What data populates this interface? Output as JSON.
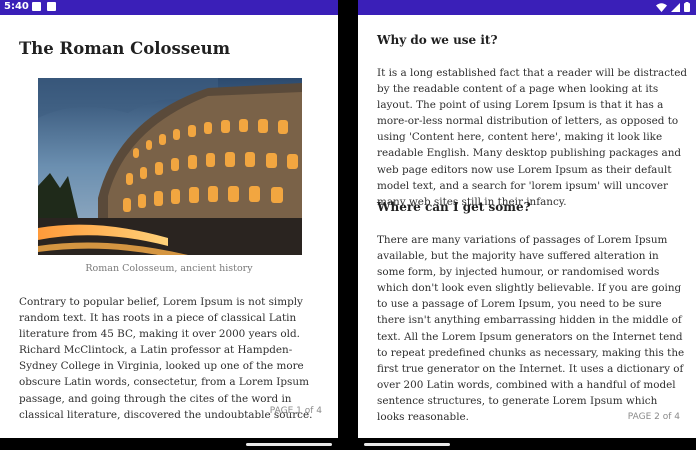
{
  "status": {
    "time": "5:40"
  },
  "left_page": {
    "title": "The Roman Colosseum",
    "image_caption": "Roman Colosseum, ancient history",
    "body": "Contrary to popular belief, Lorem Ipsum is not simply random text. It has roots in a piece of classical Latin literature from 45 BC, making it over 2000 years old. Richard McClintock, a Latin professor at Hampden-Sydney College in Virginia, looked up one of the more obscure Latin words, consectetur, from a Lorem Ipsum passage, and going through the cites of the word in classical literature, discovered the undoubtable source.",
    "page_label": "PAGE 1 of 4"
  },
  "right_page": {
    "heading1": "Why do we use it?",
    "body1": "It is a long established fact that a reader will be distracted by the readable content of a page when looking at its layout. The point of using Lorem Ipsum is that it has a more-or-less normal distribution of letters, as opposed to using 'Content here, content here', making it look like readable English. Many desktop publishing packages and web page editors now use Lorem Ipsum as their default model text, and a search for 'lorem ipsum' will uncover many web sites still in their infancy.",
    "heading2": "Where can I get some?",
    "body2": "There are many variations of passages of Lorem Ipsum available, but the majority have suffered alteration in some form, by injected humour, or randomised words which don't look even slightly believable. If you are going to use a passage of Lorem Ipsum, you need to be sure there isn't anything embarrassing hidden in the middle of text. All the Lorem Ipsum generators on the Internet tend to repeat predefined chunks as necessary, making this the first true generator on the Internet. It uses a dictionary of over 200 Latin words, combined with a handful of model sentence structures, to generate Lorem Ipsum which looks reasonable.",
    "page_label": "PAGE 2 of 4"
  },
  "colors": {
    "status_bar": "#3a1fb8",
    "page_bg": "#ffffff",
    "hinge": "#000000"
  },
  "icons": [
    "notification-a-icon",
    "notification-b-icon",
    "wifi-icon",
    "signal-icon",
    "battery-icon"
  ]
}
